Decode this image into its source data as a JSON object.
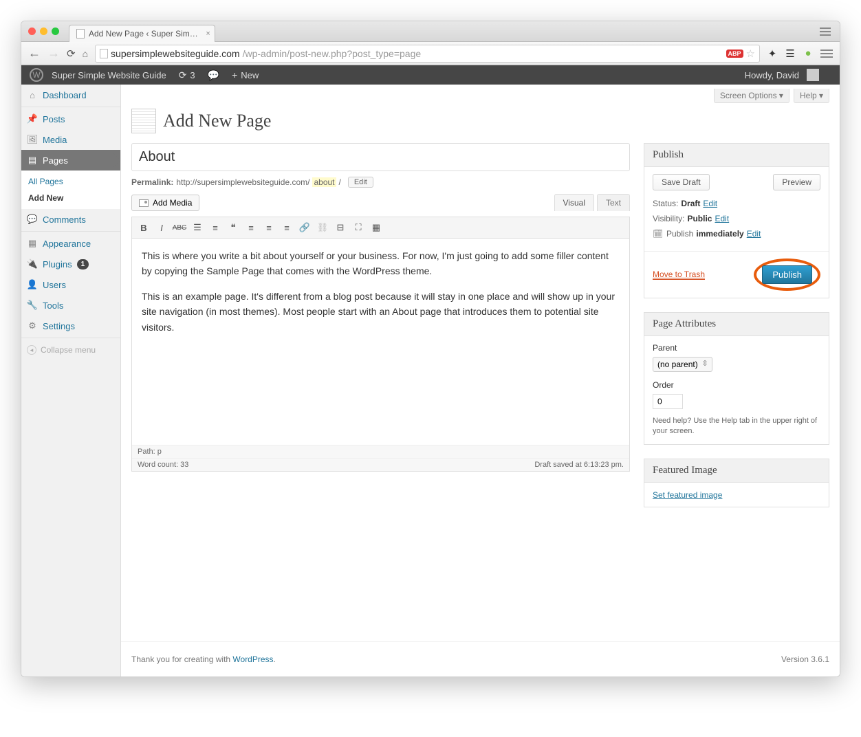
{
  "browser": {
    "tab_title": "Add New Page ‹ Super Sim…",
    "url_host": "supersimplewebsiteguide.com",
    "url_path": "/wp-admin/post-new.php?post_type=page"
  },
  "adminbar": {
    "site_name": "Super Simple Website Guide",
    "updates": "3",
    "new_label": "New",
    "greeting": "Howdy, David"
  },
  "screen_meta": {
    "screen_options": "Screen Options ▾",
    "help": "Help ▾"
  },
  "sidebar": {
    "dashboard": "Dashboard",
    "posts": "Posts",
    "media": "Media",
    "pages": "Pages",
    "pages_sub": {
      "all": "All Pages",
      "add": "Add New"
    },
    "comments": "Comments",
    "appearance": "Appearance",
    "plugins": "Plugins",
    "plugins_count": "1",
    "users": "Users",
    "tools": "Tools",
    "settings": "Settings",
    "collapse": "Collapse menu"
  },
  "page": {
    "heading": "Add New Page",
    "title_value": "About",
    "permalink_label": "Permalink:",
    "permalink_base": "http://supersimplewebsiteguide.com/",
    "permalink_slug": "about",
    "permalink_slash": "/",
    "edit_btn": "Edit",
    "add_media": "Add Media",
    "tabs": {
      "visual": "Visual",
      "text": "Text"
    },
    "content_p1": "This is where you write a bit about yourself or your business. For now, I'm just going to add some filler content by copying the Sample Page that comes with the WordPress theme.",
    "content_p2": "This is an example page. It's different from a blog post because it will stay in one place and will show up in your site navigation (in most themes). Most people start with an About page that introduces them to potential site visitors.",
    "path": "Path: p",
    "word_count": "Word count: 33",
    "draft_saved": "Draft saved at 6:13:23 pm."
  },
  "publish": {
    "title": "Publish",
    "save_draft": "Save Draft",
    "preview": "Preview",
    "status_label": "Status:",
    "status_value": "Draft",
    "visibility_label": "Visibility:",
    "visibility_value": "Public",
    "publish_label": "Publish",
    "publish_when": "immediately",
    "edit": "Edit",
    "trash": "Move to Trash",
    "publish_btn": "Publish"
  },
  "page_attributes": {
    "title": "Page Attributes",
    "parent_label": "Parent",
    "parent_value": "(no parent)",
    "order_label": "Order",
    "order_value": "0",
    "help": "Need help? Use the Help tab in the upper right of your screen."
  },
  "featured": {
    "title": "Featured Image",
    "link": "Set featured image"
  },
  "footer": {
    "thanks_pre": "Thank you for creating with ",
    "wp": "WordPress",
    "dot": ".",
    "version": "Version 3.6.1"
  }
}
